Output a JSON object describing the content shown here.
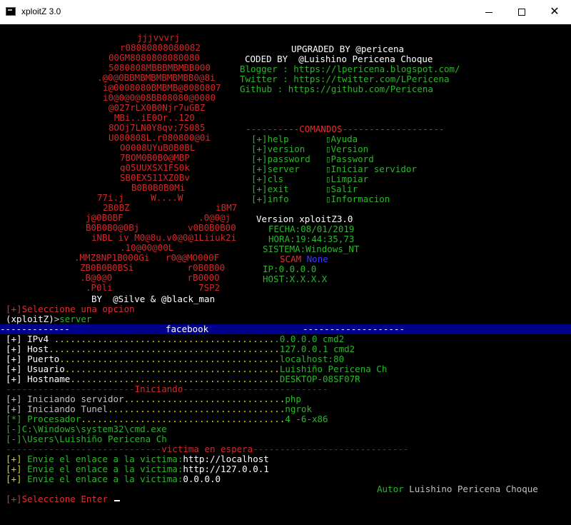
{
  "window": {
    "title": "xploitZ 3.0",
    "minimize_icon": "minimize-icon",
    "maximize_icon": "maximize-icon",
    "close_label": "✕"
  },
  "banner": {
    "ascii_art": [
      "jjjvvvrj",
      "r08080808080082",
      "00GM8080808080080",
      "5080808MBBBMBMBB000",
      ".@0@0BBMBMBMBMBMBB0@8i",
      "i@0008080BMBMB@8080807",
      "i0@0@0@08BB08080@0080",
      "@027rLX0B0Njr7uGBZ",
      "MBi..iE0Or..120",
      "8OOj7LN0Y8qv;7S085",
      "U080808L.r080800@0i",
      "O0008UYuB0B0BL",
      "7BOM0B0B0@MBP",
      "q05UUXSX1FS0k",
      "SB0EX511XZ0Bv",
      "B0B0B0B0Mi",
      "77i.j     W....W",
      "2B0BZ                iBM7",
      "j@0B0BF              .0@0@j",
      "B0B0B0@0Bj         v0B0B0B00",
      "iNBL iv M0@8u.v0@0@1Liiuk2i",
      ".10@00@00L",
      ".MMZ8NP1B000Gi   r0@@MO000F",
      "ZB0B0B0BSi          r0B0B00",
      ".B@0@0              rB000O",
      ".P0li                7SP2"
    ],
    "by_line": "BY  @Silve & @black_man",
    "upgraded": "UPGRADED BY @pericena",
    "coded": "CODED BY  @Luishino Pericena Choque",
    "blogger": "Blogger : https://lpericena.blogspot.com/",
    "twitter": "Twitter : https://twitter.com/LPericena",
    "github": "Github : https://github.com/Pericena",
    "commands_header_left": "----------",
    "commands_header_title": "COMANDOS",
    "commands_header_right": "-------------------",
    "commands": [
      {
        "cmd": "[+]help",
        "desc": "▯Ayuda"
      },
      {
        "cmd": "[+]version",
        "desc": "▯Version"
      },
      {
        "cmd": "[+]password",
        "desc": "▯Password"
      },
      {
        "cmd": "[+]server",
        "desc": "▯Iniciar servidor"
      },
      {
        "cmd": "[+]cls",
        "desc": "▯Limpiar"
      },
      {
        "cmd": "[+]exit",
        "desc": "▯Salir"
      },
      {
        "cmd": "[+]info",
        "desc": "▯Informacion"
      }
    ],
    "version": "Version xploitZ3.0",
    "fecha": "FECHA:08/01/2019",
    "hora": "HORA:19:44:35,73",
    "sistema": "SISTEMA:Windows_NT",
    "scam_label": "SCAM",
    "scam_value": "None",
    "ip": "IP:0.0.0.0",
    "host": "HOST:X.X.X.X"
  },
  "prompt": {
    "select_option": "[+]Seleccione una opcion",
    "prompt_name": "(xploitZ)",
    "prompt_arrow": ">",
    "command": "server"
  },
  "facebook_bar": {
    "left": "-------------",
    "title": "facebook",
    "right": "-------------------"
  },
  "details": [
    {
      "bullet": "[+]",
      "label": " IPv4",
      "dots": " .........................................",
      "value": ".0.0.0.0 cmd2"
    },
    {
      "bullet": "[+]",
      "label": " Host",
      "dots": "...........................................",
      "value": "127.0.0.1 cmd2"
    },
    {
      "bullet": "[+]",
      "label": " Puerto",
      "dots": ".........................................",
      "value": "localhost:80"
    },
    {
      "bullet": "[+]",
      "label": " Usuario",
      "dots": "........................................",
      "value": "Luishiño Pericena Ch"
    },
    {
      "bullet": "[+]",
      "label": " Hostname",
      "dots": ".......................................",
      "value": "DESKTOP-08SF07R"
    }
  ],
  "iniciando": {
    "left": "------------------------",
    "title": "Iniciando",
    "right": "---------------------------"
  },
  "startup": [
    {
      "bullet": "[+]",
      "label": " Iniciando servidor",
      "dots": "..............................",
      "value": "php",
      "style": "gray"
    },
    {
      "bullet": "[+]",
      "label": " Iniciando Tunel",
      "dots": ".................................",
      "value": "ngrok",
      "style": "gray"
    },
    {
      "bullet": "[*]",
      "label": " Procesador",
      "dots": "......................................",
      "value": "4 -6-x86",
      "style": "green"
    }
  ],
  "paths": [
    "[-]C:\\Windows\\system32\\cmd.exe",
    "[-]\\Users\\Luishiño Pericena Ch"
  ],
  "victima": {
    "left": "-----------------------------",
    "title": "victima en espera",
    "right": "-----------------------------"
  },
  "links": [
    {
      "bullet": "[+]",
      "text": " Envie el enlace a la victima:",
      "value": "http://localhost"
    },
    {
      "bullet": "[+]",
      "text": " Envie el enlace a la victima:",
      "value": "http://127.0.0.1"
    },
    {
      "bullet": "[+]",
      "text": " Envie el enlace a la victima:",
      "value": "0.0.0.0"
    }
  ],
  "author": {
    "label": "Autor",
    "name": "Luishino Pericena Choque"
  },
  "final_prompt": "[+]Seleccione Enter"
}
